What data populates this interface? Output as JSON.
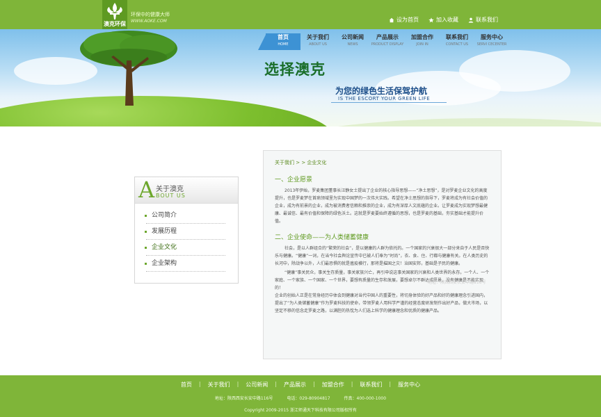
{
  "header": {
    "logo_name": "澳克环保",
    "slogan_main": "环保中的健康大师",
    "slogan_url": "WWW.AOKE.COM",
    "links": [
      {
        "label": "设为首页",
        "icon": "home-icon"
      },
      {
        "label": "加入收藏",
        "icon": "star-icon"
      },
      {
        "label": "联系我们",
        "icon": "user-icon"
      }
    ]
  },
  "nav": [
    {
      "cn": "首页",
      "en": "HOME"
    },
    {
      "cn": "关于我们",
      "en": "ABOUT US"
    },
    {
      "cn": "公司新闻",
      "en": "NEWS"
    },
    {
      "cn": "产品展示",
      "en": "PRODUCT DISPLAY"
    },
    {
      "cn": "加盟合作",
      "en": "JOIN IN"
    },
    {
      "cn": "联系我们",
      "en": "CONTACT US"
    },
    {
      "cn": "服务中心",
      "en": "SERVI CECENTER"
    }
  ],
  "banner": {
    "headline": "选择澳克",
    "sub_cn": "为您的绿色生活保驾护航",
    "sub_en": "IS THE ESCORT YOUR GREEN LIFE"
  },
  "sidebar": {
    "letter": "A",
    "title_cn": "关于澳克",
    "title_en": "BOUT US",
    "items": [
      "公司简介",
      "发展历程",
      "企业文化",
      "企业架构"
    ]
  },
  "content": {
    "breadcrumb": "关于我们 > > 企业文化",
    "section1_title": "一、企业愿景",
    "section1_text": "2013年伊始，罗麦集团董事长汪静女士提出了企业的核心指导思想——“净土思想”，是对罗麦企业文化的高度提升，也是罗麦梦在首病领域里为实现中国梦的一次伟大实践。希望在净土思想的指导下，罗麦将成为有社会价值的企业，成为有前景的企业，成为被消费者信赖和推崇的企业，成为有深厚人文底蕴的企业。让罗麦成为实现梦想最健康、最诚信、最有价值和保障的绿色沃土。这就是罗麦要始终遵循的思想，也是罗麦的基础，夯实基础才能提升价值。",
    "section2_title": "二、企业使命——为人类储蓄健康",
    "section2_text1": "社会，是以人群组合的“繁荣的社会”，是以健康的人群为依托的。一个国家的兴衰很大一部分来自于人民是否快乐与健康。“健康”一词，在当今社会舆论宣传中已被人们奉为“时尚”，衣、食、住、行都与健康有关。在人类历史的长河中，除战争以外，人们最恐惧的就是瘟疫横行，那将是摧国之灾！治国安邦，基础是子民的健康。",
    "section2_text2": "“健康”事关民众，事关生存质量，事关家族兴亡，再引申说这事关国家的兴衰和人类世界的永存。一个人、一个家庭、一个家族、一个国家、一个世界，要想有质量的生存和发展，要想卓尔不群达成愿景，没有健康是不能实现的！",
    "section2_text3": "企业的创始人正是在常身经历中体会到健康对当代中国人的重要性，将切身体验的好产品和好的健康理念引进国内，提出了“为人类储蓄健康”作为罗麦科技的使命，带领罗麦人用科学严谨的经营态度研发制作出好产品，做大市场，以坚定不移的信念走罗麦之路，以满腔的热忱为人们选上科学的健康理念和优质的健康产品。",
    "watermark": "地址：陕西西安长安中路116号"
  },
  "footer": {
    "nav": [
      "首页",
      "关于我们",
      "公司新闻",
      "产品展示",
      "加盟合作",
      "联系我们",
      "服务中心"
    ],
    "address": "地址：陕西西安长安中路116号",
    "phone": "电话：029-80904817",
    "hotline": "传真：400-000-1000",
    "copyright": "Copyright 2009-2015 浙江师通天下科技有限公司版权所有"
  },
  "colors": {
    "brand_green": "#7fb539",
    "nav_active": "#3d92d4",
    "headline_green": "#1a6e2a"
  }
}
